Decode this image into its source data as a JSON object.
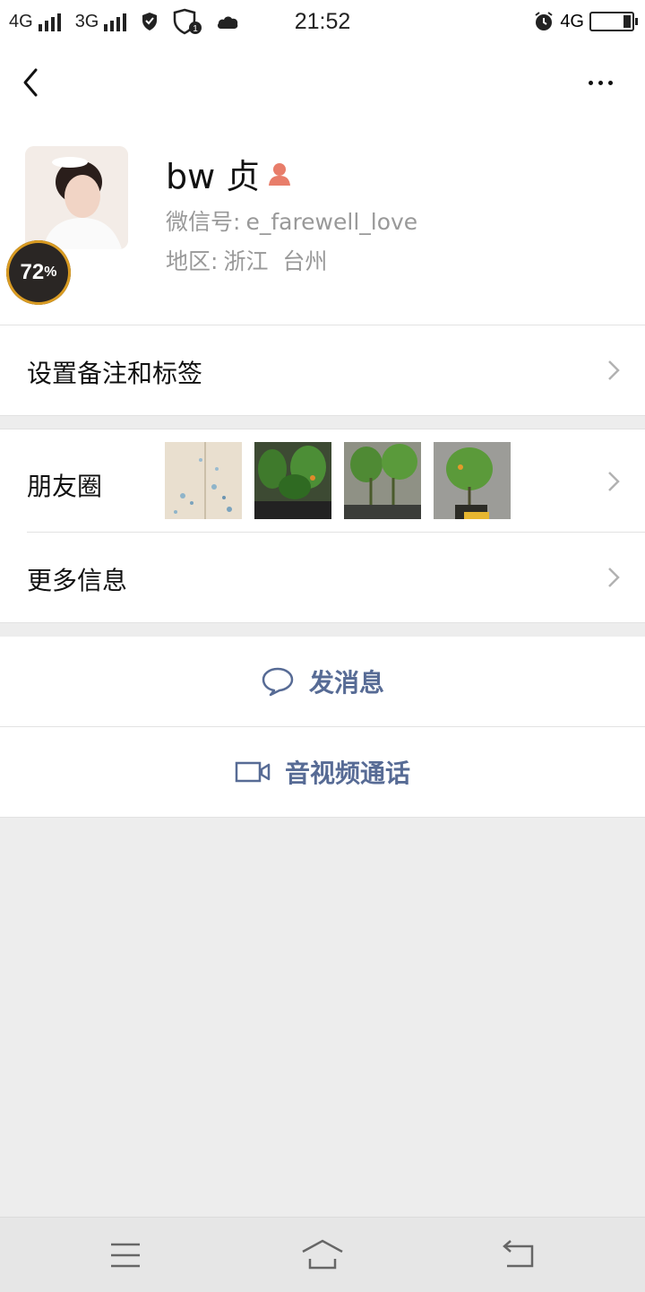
{
  "status_bar": {
    "network1": "4G",
    "network2": "3G",
    "time": "21:52",
    "network_right": "4G"
  },
  "profile": {
    "name": "bw 贞",
    "wechat_id_label": "微信号:",
    "wechat_id": "e_farewell_love",
    "region_label": "地区:",
    "region": "浙江  台州",
    "badge_value": "72",
    "badge_unit": "%"
  },
  "rows": {
    "remark_label": "设置备注和标签",
    "moments_label": "朋友圈",
    "more_info_label": "更多信息"
  },
  "actions": {
    "message_label": "发消息",
    "call_label": "音视频通话"
  },
  "colors": {
    "accent": "#576b95",
    "page_bg": "#ededed"
  },
  "icons": {
    "back": "chevron-left-icon",
    "more": "more-dots-icon",
    "gender": "female-icon",
    "message": "chat-bubble-icon",
    "call": "video-camera-icon",
    "nav_menu": "menu-icon",
    "nav_home": "home-icon",
    "nav_back": "return-icon"
  }
}
